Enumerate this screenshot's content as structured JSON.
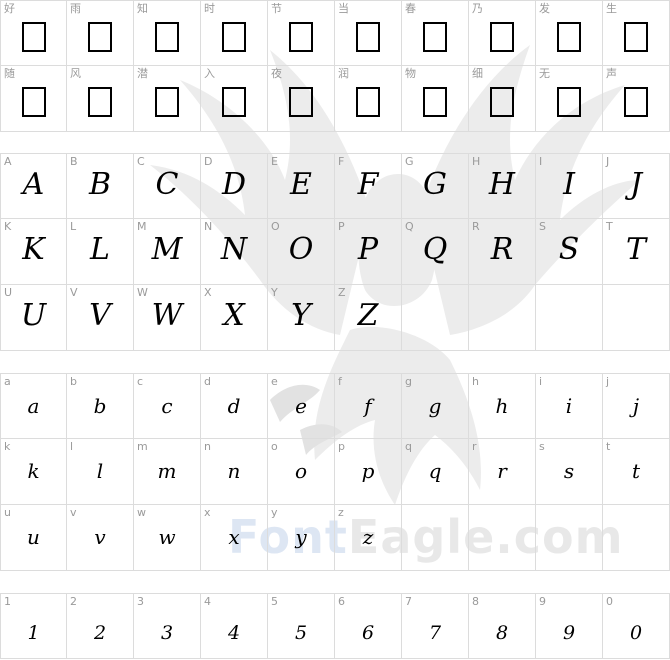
{
  "watermark": {
    "part1": "Font",
    "part2": "Eagle.com"
  },
  "cjk": {
    "rows": [
      [
        "好",
        "雨",
        "知",
        "时",
        "节",
        "当",
        "春",
        "乃",
        "发",
        "生"
      ],
      [
        "随",
        "风",
        "潜",
        "入",
        "夜",
        "润",
        "物",
        "细",
        "无",
        "声"
      ]
    ]
  },
  "upper": {
    "rows": [
      [
        "A",
        "B",
        "C",
        "D",
        "E",
        "F",
        "G",
        "H",
        "I",
        "J"
      ],
      [
        "K",
        "L",
        "M",
        "N",
        "O",
        "P",
        "Q",
        "R",
        "S",
        "T"
      ],
      [
        "U",
        "V",
        "W",
        "X",
        "Y",
        "Z"
      ]
    ]
  },
  "lower": {
    "rows": [
      [
        "a",
        "b",
        "c",
        "d",
        "e",
        "f",
        "g",
        "h",
        "i",
        "j"
      ],
      [
        "k",
        "l",
        "m",
        "n",
        "o",
        "p",
        "q",
        "r",
        "s",
        "t"
      ],
      [
        "u",
        "v",
        "w",
        "x",
        "y",
        "z"
      ]
    ]
  },
  "digits": {
    "rows": [
      [
        "1",
        "2",
        "3",
        "4",
        "5",
        "6",
        "7",
        "8",
        "9",
        "0"
      ]
    ]
  }
}
